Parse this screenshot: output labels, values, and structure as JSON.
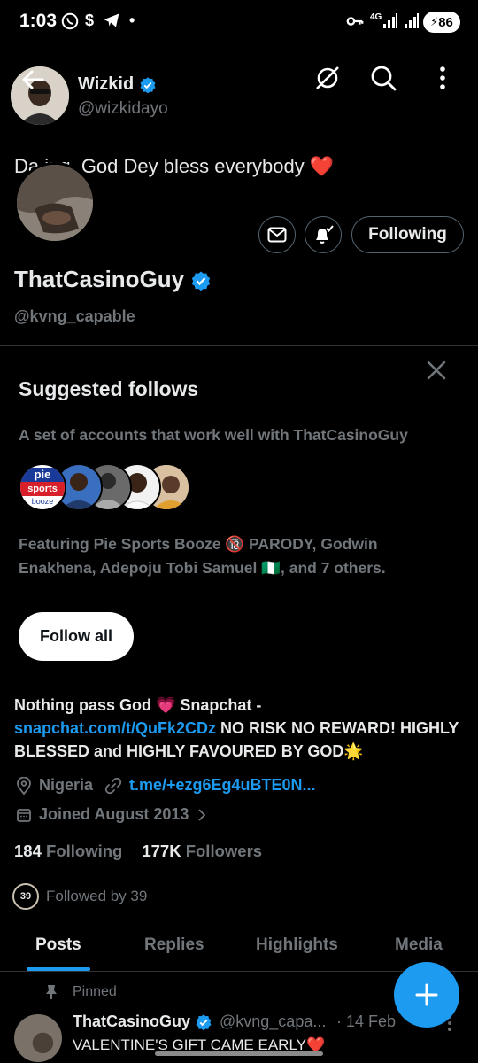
{
  "status_bar": {
    "time": "1:03",
    "battery": "86",
    "network": "4G"
  },
  "header": {
    "name": "Wizkid",
    "handle": "@wizkidayo",
    "pinned_preview": "Da    ing. God Dey bless everybody ❤️"
  },
  "profile": {
    "display_name": "ThatCasinoGuy",
    "handle": "@kvng_capable",
    "following_button": "Following",
    "bio_part1": "Nothing pass God 💗 Snapchat - ",
    "bio_link": "snapchat.com/t/QuFk2CDz",
    "bio_part2": " NO RISK NO REWARD! HIGHLY BLESSED and HIGHLY FAVOURED BY GOD🌟",
    "location": "Nigeria",
    "website": "t.me/+ezg6Eg4uBTE0N...",
    "joined": "Joined August 2013",
    "following_count": "184",
    "following_label": "Following",
    "followers_count": "177K",
    "followers_label": "Followers",
    "followed_by_badge": "39",
    "followed_by": "Followed by 39"
  },
  "suggested": {
    "title": "Suggested follows",
    "subtitle": "A set of accounts that work well with ThatCasinoGuy",
    "featuring": "Featuring Pie Sports Booze 🔞 PARODY, Godwin Enakhena, Adepoju Tobi Samuel 🇳🇬, and 7 others.",
    "follow_all": "Follow all",
    "pie_logo_top": "pie",
    "pie_logo_mid": "sports",
    "pie_logo_bottom": "booze"
  },
  "tabs": [
    "Posts",
    "Replies",
    "Highlights",
    "Media"
  ],
  "post": {
    "pinned_label": "Pinned",
    "author": "ThatCasinoGuy",
    "handle": "@kvng_capa...",
    "date": "· 14 Feb",
    "text": "VALENTINE'S GIFT CAME EARLY❤️"
  },
  "colors": {
    "accent": "#1d9bf0",
    "background": "#000000",
    "secondary_text": "#71767b"
  }
}
